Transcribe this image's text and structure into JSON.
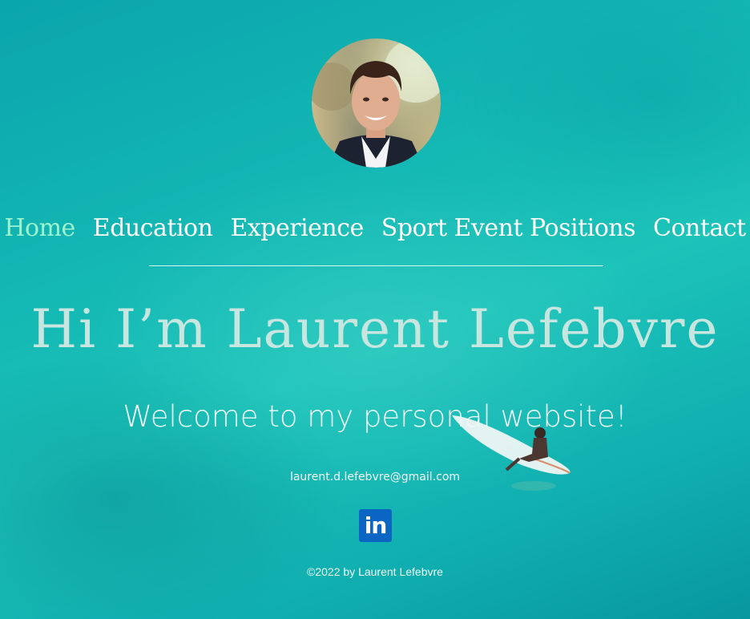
{
  "nav": {
    "items": [
      {
        "label": "Home",
        "active": true
      },
      {
        "label": "Education",
        "active": false
      },
      {
        "label": "Experience",
        "active": false
      },
      {
        "label": "Sport Event Positions",
        "active": false
      },
      {
        "label": "Contact",
        "active": false
      }
    ]
  },
  "hero": {
    "headline": "Hi I’m Laurent Lefebvre",
    "welcome": "Welcome to my personal website!"
  },
  "contact": {
    "email": "laurent.d.lefebvre@gmail.com",
    "linkedin_icon_text": "in"
  },
  "footer": {
    "copyright": "©2022 by Laurent Lefebvre"
  },
  "colors": {
    "active_nav": "#9df2cf",
    "nav_text": "#ffffff",
    "linkedin": "#0a66c2",
    "sea": "#14b8b4"
  },
  "icons": {
    "profile_photo": "profile-photo",
    "linkedin": "linkedin-icon"
  }
}
